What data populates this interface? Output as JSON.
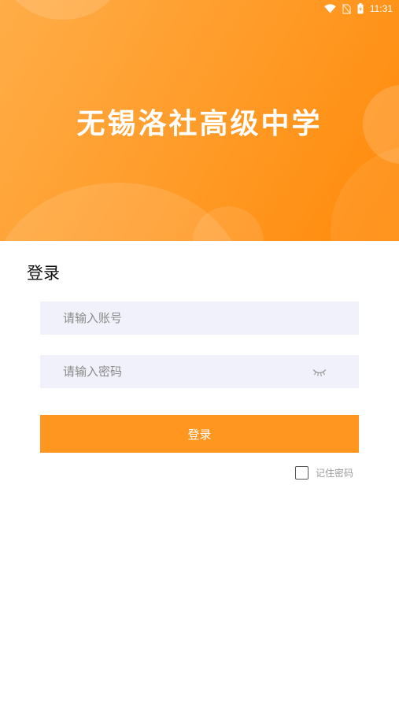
{
  "status_bar": {
    "time": "11:31",
    "icons": [
      "wifi-icon",
      "no-sim-icon",
      "battery-charging-icon"
    ]
  },
  "header": {
    "school_name": "无锡洛社高级中学"
  },
  "login": {
    "heading": "登录",
    "account_placeholder": "请输入账号",
    "account_value": "",
    "password_placeholder": "请输入密码",
    "password_value": "",
    "password_toggle_icon": "eye-closed-icon",
    "submit_label": "登录",
    "remember_label": "记住密码",
    "remember_checked": false
  },
  "colors": {
    "accent": "#ff9620",
    "hero_start": "#ffad48",
    "hero_end": "#ff8a0a",
    "input_bg": "#f1f1fb"
  }
}
